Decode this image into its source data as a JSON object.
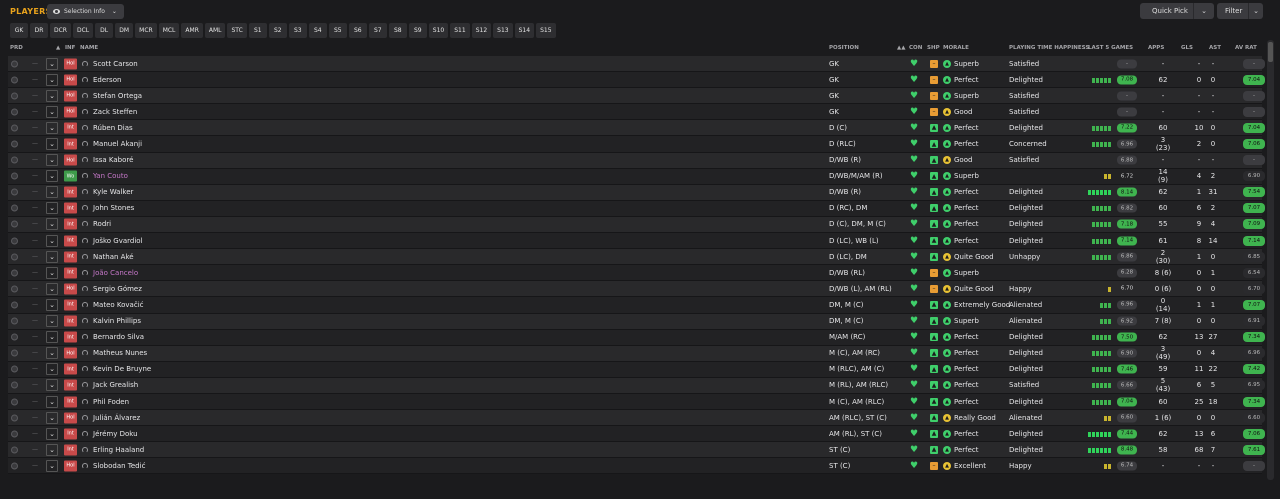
{
  "header": {
    "title": "PLAYERS",
    "selection_info": "Selection Info",
    "quick_pick": "Quick Pick",
    "filter": "Filter"
  },
  "position_tabs": [
    "GK",
    "DR",
    "DCR",
    "DCL",
    "DL",
    "DM",
    "MCR",
    "MCL",
    "AMR",
    "AML",
    "STC",
    "S1",
    "S2",
    "S3",
    "S4",
    "S5",
    "S6",
    "S7",
    "S8",
    "S9",
    "S10",
    "S11",
    "S12",
    "S13",
    "S14",
    "S15"
  ],
  "columns": {
    "prd": "PRD",
    "inf": "INF",
    "name": "NAME",
    "position": "POSITION",
    "con": "CON",
    "shp": "SHP",
    "morale": "MORALE",
    "pth": "PLAYING TIME HAPPINESS",
    "last5": "LAST 5 GAMES",
    "apps": "APPS",
    "gls": "GLS",
    "ast": "AST",
    "avrat": "AV RAT"
  },
  "colors": {
    "accent": "#e8a21c",
    "green": "#3fb44f",
    "red_badge": "#c84a4a",
    "loan_name": "#c678c9"
  },
  "players": [
    {
      "inf": "Hol",
      "name": "Scott Carson",
      "pos": "GK",
      "shp": "o",
      "mor_icon": "g",
      "morale": "Superb",
      "pth": "Satisfied",
      "form": 0,
      "rating": "-",
      "apps": "-",
      "gls": "-",
      "ast": "-",
      "avrat": "-",
      "avstyle": "grey"
    },
    {
      "inf": "Hol",
      "name": "Ederson",
      "pos": "GK",
      "shp": "o",
      "mor_icon": "g",
      "morale": "Perfect",
      "pth": "Delighted",
      "form": 5,
      "rating": "7.08",
      "apps": "62",
      "gls": "0",
      "ast": "0",
      "avrat": "7.04",
      "ratstyle": "green",
      "avstyle": "green"
    },
    {
      "inf": "Hol",
      "name": "Stefan Ortega",
      "pos": "GK",
      "shp": "o",
      "mor_icon": "g",
      "morale": "Superb",
      "pth": "Satisfied",
      "form": 0,
      "rating": "-",
      "apps": "-",
      "gls": "-",
      "ast": "-",
      "avrat": "-",
      "avstyle": "grey"
    },
    {
      "inf": "Hol",
      "name": "Zack Steffen",
      "pos": "GK",
      "shp": "o",
      "mor_icon": "y",
      "morale": "Good",
      "pth": "Satisfied",
      "form": 0,
      "rating": "-",
      "apps": "-",
      "gls": "-",
      "ast": "-",
      "avrat": "-",
      "avstyle": "grey"
    },
    {
      "inf": "Int",
      "name": "Rúben Dias",
      "pos": "D (C)",
      "shp": "g",
      "mor_icon": "g",
      "morale": "Perfect",
      "pth": "Delighted",
      "form": 5,
      "rating": "7.22",
      "apps": "60",
      "gls": "10",
      "ast": "0",
      "avrat": "7.04",
      "ratstyle": "green",
      "avstyle": "green"
    },
    {
      "inf": "Int",
      "name": "Manuel Akanji",
      "pos": "D (RLC)",
      "shp": "g",
      "mor_icon": "g",
      "morale": "Perfect",
      "pth": "Concerned",
      "form": 5,
      "rating": "6.96",
      "apps": "3 (23)",
      "gls": "2",
      "ast": "0",
      "avrat": "7.06",
      "ratstyle": "grey",
      "avstyle": "green"
    },
    {
      "inf": "Hol",
      "name": "Issa Kaboré",
      "pos": "D/WB (R)",
      "shp": "g",
      "mor_icon": "y",
      "morale": "Good",
      "pth": "Satisfied",
      "form": 0,
      "rating": "6.88",
      "apps": "-",
      "gls": "-",
      "ast": "-",
      "avrat": "-",
      "ratstyle": "grey",
      "avstyle": "grey"
    },
    {
      "inf": "Wo",
      "name": "Yan Couto",
      "loan": true,
      "pos": "D/WB/M/AM (R)",
      "shp": "g",
      "mor_icon": "g",
      "morale": "Superb",
      "pth": "",
      "form": 2,
      "rating": "6.72",
      "apps": "14 (9)",
      "gls": "4",
      "ast": "2",
      "avrat": "6.90",
      "ratstyle": "none",
      "avstyle": "dark"
    },
    {
      "inf": "Int",
      "name": "Kyle Walker",
      "pos": "D/WB (R)",
      "shp": "g",
      "mor_icon": "g",
      "morale": "Perfect",
      "pth": "Delighted",
      "form": 6,
      "rating": "8.14",
      "apps": "62",
      "gls": "1",
      "ast": "31",
      "avrat": "7.54",
      "ratstyle": "green",
      "avstyle": "green"
    },
    {
      "inf": "Int",
      "name": "John Stones",
      "pos": "D (RC), DM",
      "shp": "g",
      "mor_icon": "g",
      "morale": "Perfect",
      "pth": "Delighted",
      "form": 5,
      "rating": "6.82",
      "apps": "60",
      "gls": "6",
      "ast": "2",
      "avrat": "7.07",
      "ratstyle": "grey",
      "avstyle": "green"
    },
    {
      "inf": "Int",
      "name": "Rodri",
      "pos": "D (C), DM, M (C)",
      "shp": "g",
      "mor_icon": "g",
      "morale": "Perfect",
      "pth": "Delighted",
      "form": 5,
      "rating": "7.18",
      "apps": "55",
      "gls": "9",
      "ast": "4",
      "avrat": "7.09",
      "ratstyle": "green",
      "avstyle": "green"
    },
    {
      "inf": "Int",
      "name": "Joško Gvardiol",
      "pos": "D (LC), WB (L)",
      "shp": "g",
      "mor_icon": "g",
      "morale": "Perfect",
      "pth": "Delighted",
      "form": 5,
      "rating": "7.14",
      "apps": "61",
      "gls": "8",
      "ast": "14",
      "avrat": "7.14",
      "ratstyle": "green",
      "avstyle": "green"
    },
    {
      "inf": "Int",
      "name": "Nathan Aké",
      "pos": "D (LC), DM",
      "shp": "g",
      "mor_icon": "y",
      "morale": "Quite Good",
      "pth": "Unhappy",
      "form": 5,
      "rating": "6.86",
      "apps": "2 (30)",
      "gls": "1",
      "ast": "0",
      "avrat": "6.85",
      "ratstyle": "grey",
      "avstyle": "dark"
    },
    {
      "inf": "Int",
      "name": "João Cancelo",
      "loan": true,
      "pos": "D/WB (RL)",
      "shp": "o",
      "mor_icon": "g",
      "morale": "Superb",
      "pth": "",
      "form": 0,
      "rating": "6.28",
      "apps": "8 (6)",
      "gls": "0",
      "ast": "1",
      "avrat": "6.54",
      "ratstyle": "grey",
      "avstyle": "dark"
    },
    {
      "inf": "Hol",
      "name": "Sergio Gómez",
      "pos": "D/WB (L), AM (RL)",
      "shp": "o",
      "mor_icon": "y",
      "morale": "Quite Good",
      "pth": "Happy",
      "form": 1,
      "rating": "6.70",
      "apps": "0 (6)",
      "gls": "0",
      "ast": "0",
      "avrat": "6.70",
      "ratstyle": "none",
      "avstyle": "dark"
    },
    {
      "inf": "Int",
      "name": "Mateo Kovačić",
      "pos": "DM, M (C)",
      "shp": "g",
      "mor_icon": "g",
      "morale": "Extremely Good",
      "pth": "Alienated",
      "form": 3,
      "rating": "6.96",
      "apps": "0 (14)",
      "gls": "1",
      "ast": "1",
      "avrat": "7.07",
      "ratstyle": "grey",
      "avstyle": "green"
    },
    {
      "inf": "Int",
      "name": "Kalvin Phillips",
      "pos": "DM, M (C)",
      "shp": "g",
      "mor_icon": "g",
      "morale": "Superb",
      "pth": "Alienated",
      "form": 3,
      "rating": "6.92",
      "apps": "7 (8)",
      "gls": "0",
      "ast": "0",
      "avrat": "6.91",
      "ratstyle": "grey",
      "avstyle": "dark"
    },
    {
      "inf": "Int",
      "name": "Bernardo Silva",
      "pos": "M/AM (RC)",
      "shp": "g",
      "mor_icon": "g",
      "morale": "Perfect",
      "pth": "Delighted",
      "form": 5,
      "rating": "7.50",
      "apps": "62",
      "gls": "13",
      "ast": "27",
      "avrat": "7.34",
      "ratstyle": "green",
      "avstyle": "green"
    },
    {
      "inf": "Hol",
      "name": "Matheus Nunes",
      "pos": "M (C), AM (RC)",
      "shp": "g",
      "mor_icon": "g",
      "morale": "Perfect",
      "pth": "Delighted",
      "form": 5,
      "rating": "6.90",
      "apps": "3 (49)",
      "gls": "0",
      "ast": "4",
      "avrat": "6.96",
      "ratstyle": "grey",
      "avstyle": "dark"
    },
    {
      "inf": "Int",
      "name": "Kevin De Bruyne",
      "pos": "M (RLC), AM (C)",
      "shp": "g",
      "mor_icon": "g",
      "morale": "Perfect",
      "pth": "Delighted",
      "form": 5,
      "rating": "7.46",
      "apps": "59",
      "gls": "11",
      "ast": "22",
      "avrat": "7.42",
      "ratstyle": "green",
      "avstyle": "green"
    },
    {
      "inf": "Int",
      "name": "Jack Grealish",
      "pos": "M (RL), AM (RLC)",
      "shp": "g",
      "mor_icon": "g",
      "morale": "Perfect",
      "pth": "Satisfied",
      "form": 5,
      "rating": "6.66",
      "apps": "5 (43)",
      "gls": "6",
      "ast": "5",
      "avrat": "6.95",
      "ratstyle": "grey",
      "avstyle": "dark"
    },
    {
      "inf": "Int",
      "name": "Phil Foden",
      "pos": "M (C), AM (RLC)",
      "shp": "g",
      "mor_icon": "g",
      "morale": "Perfect",
      "pth": "Delighted",
      "form": 5,
      "rating": "7.04",
      "apps": "60",
      "gls": "25",
      "ast": "18",
      "avrat": "7.34",
      "ratstyle": "green",
      "avstyle": "green"
    },
    {
      "inf": "Hol",
      "name": "Julián Álvarez",
      "pos": "AM (RLC), ST (C)",
      "shp": "g",
      "mor_icon": "y",
      "morale": "Really Good",
      "pth": "Alienated",
      "form": 2,
      "rating": "6.60",
      "apps": "1 (6)",
      "gls": "0",
      "ast": "0",
      "avrat": "6.60",
      "ratstyle": "grey",
      "avstyle": "dark"
    },
    {
      "inf": "Int",
      "name": "Jérémy Doku",
      "pos": "AM (RL), ST (C)",
      "shp": "g",
      "mor_icon": "g",
      "morale": "Perfect",
      "pth": "Delighted",
      "form": 6,
      "rating": "7.44",
      "apps": "62",
      "gls": "13",
      "ast": "6",
      "avrat": "7.06",
      "ratstyle": "green",
      "avstyle": "green"
    },
    {
      "inf": "Int",
      "name": "Erling Haaland",
      "pos": "ST (C)",
      "shp": "g",
      "mor_icon": "g",
      "morale": "Perfect",
      "pth": "Delighted",
      "form": 6,
      "rating": "8.48",
      "apps": "58",
      "gls": "68",
      "ast": "7",
      "avrat": "7.61",
      "ratstyle": "green",
      "avstyle": "green"
    },
    {
      "inf": "Hol",
      "name": "Slobodan Tedić",
      "pos": "ST (C)",
      "shp": "o",
      "mor_icon": "y",
      "morale": "Excellent",
      "pth": "Happy",
      "form": 2,
      "rating": "6.74",
      "apps": "-",
      "gls": "-",
      "ast": "-",
      "avrat": "-",
      "ratstyle": "grey",
      "avstyle": "grey"
    }
  ]
}
